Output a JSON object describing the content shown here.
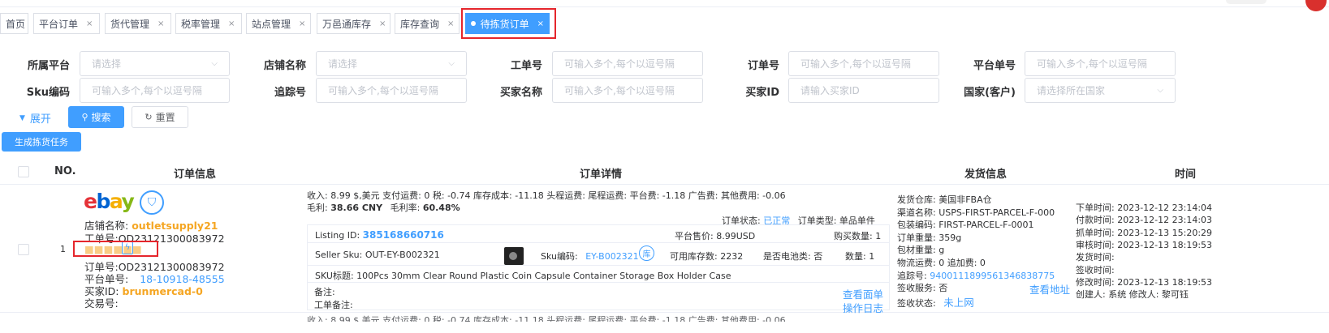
{
  "tabs": [
    {
      "label": "首页",
      "closable": false
    },
    {
      "label": "平台订单",
      "closable": true
    },
    {
      "label": "货代管理",
      "closable": true
    },
    {
      "label": "税率管理",
      "closable": true
    },
    {
      "label": "站点管理",
      "closable": true
    },
    {
      "label": "万邑通库存",
      "closable": true
    },
    {
      "label": "库存查询",
      "closable": true
    },
    {
      "label": "待拣货订单",
      "closable": true,
      "active": true
    }
  ],
  "close_glyph": "×",
  "filters": {
    "platform": {
      "label": "所属平台",
      "placeholder": "请选择"
    },
    "store_name": {
      "label": "店铺名称",
      "placeholder": "请选择"
    },
    "work_no": {
      "label": "工单号",
      "placeholder": "可输入多个,每个以逗号隔"
    },
    "order_no": {
      "label": "订单号",
      "placeholder": "可输入多个,每个以逗号隔"
    },
    "platform_no": {
      "label": "平台单号",
      "placeholder": "可输入多个,每个以逗号隔"
    },
    "sku": {
      "label": "Sku编码",
      "placeholder": "可输入多个,每个以逗号隔"
    },
    "tracking": {
      "label": "追踪号",
      "placeholder": "可输入多个,每个以逗号隔"
    },
    "buyer_name": {
      "label": "买家名称",
      "placeholder": "可输入多个,每个以逗号隔"
    },
    "buyer_id": {
      "label": "买家ID",
      "placeholder": "请输入买家ID"
    },
    "country": {
      "label": "国家(客户)",
      "placeholder": "请选择所在国家"
    }
  },
  "actions": {
    "expand": "展开",
    "search": "搜索",
    "reset": "重置",
    "generate": "生成拣货任务"
  },
  "table": {
    "headers": {
      "no": "NO.",
      "order_info": "订单信息",
      "order_detail": "订单详情",
      "ship_info": "发货信息",
      "time": "时间"
    }
  },
  "order": {
    "index": "1",
    "platform_logo": "ebay",
    "store_label": "店铺名称:",
    "store_value": "outletsupply21",
    "work_label": "工单号:",
    "work_value": "OD23121300083972",
    "masked_value": "■■■■■■",
    "order_label": "订单号:",
    "order_value": "OD23121300083972",
    "platform_no_label": "平台单号:",
    "platform_no_value": "18-10918-48555",
    "buyer_id_label": "买家ID:",
    "buyer_id_value": "brunmercad-0",
    "trade_label": "交易号:",
    "fees_line1": "收入: 8.99 $,美元   支付运费: 0   税: -0.74   库存成本: -11.18   头程运费:       尾程运费:       平台费: -1.18   广告费:       其他费用: -0.06",
    "profit_label": "毛利:",
    "profit_value": "38.66 CNY",
    "margin_label": "毛利率:",
    "margin_value": "60.48%",
    "status_label": "订单状态:",
    "status_value": "已正常",
    "type_label": "订单类型: 单品单件",
    "listing_label": "Listing ID:",
    "listing_value": "385168660716",
    "price_label": "平台售价: 8.99USD",
    "buy_qty_label": "购买数量: 1",
    "seller_sku_label": "Seller Sku: OUT-EY-B002321",
    "sku_code_label": "Sku编码:",
    "sku_code_value": "EY-B002321",
    "ku_badge": "库",
    "stock_label": "可用库存数: 2232",
    "battery_label": "是否电池类: 否",
    "qty_label": "数量: 1",
    "sku_title": "SKU标题: 100Pcs 30mm Clear Round Plastic Coin Capsule Container Storage Box Holder Case",
    "remark_label": "备注:",
    "work_remark_label": "工单备注:",
    "view_order_link": "查看面单",
    "op_log_link": "操作日志",
    "ship": {
      "warehouse": "发货仓库: 美国非FBA仓",
      "channel": "渠道名称: USPS-FIRST-PARCEL-F-000",
      "package": "包装编码: FIRST-PARCEL-F-0001",
      "weight": "订单重量: 359g",
      "pkg_weight": "包材重量: g",
      "freight": "物流运费: 0   追加费: 0",
      "tracking_label": "追踪号:",
      "tracking_value": "940011189956134683877​5",
      "sign_service": "签收服务: 否",
      "sign_status_label": "签收状态:",
      "sign_status_value": "未上网",
      "view_address": "查看地址"
    },
    "times": {
      "order_time": "下单时间: 2023-12-12 23:14:04",
      "pay_time": "付款时间: 2023-12-12 23:14:03",
      "grab_time": "抓单时间: 2023-12-13 15:20:29",
      "audit_time": "审核时间: 2023-12-13 18:19:53",
      "ship_time": "发货时间:",
      "sign_time": "签收时间:",
      "modify_time": "修改时间: 2023-12-13 18:19:53",
      "creator": "创建人: 系统   修改人: 黎可钰"
    }
  },
  "next_row_partial": "收入: 8.99 $,美元   支付运费: 0   税: -0.74   库存成本: -11.18   头程运费:       尾程运费:       平台费: -1.18   广告费:       其他费用: -0.06"
}
